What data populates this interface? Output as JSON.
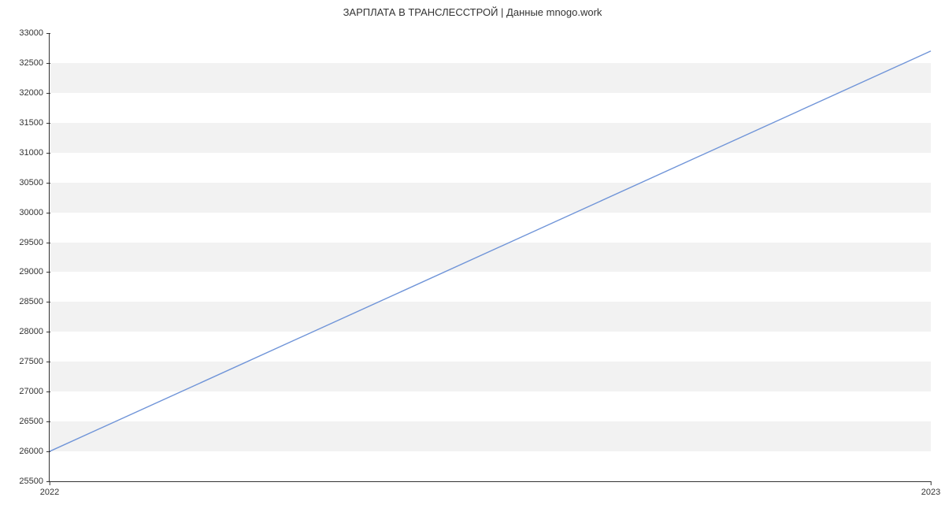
{
  "chart_data": {
    "type": "line",
    "title": "ЗАРПЛАТА В  ТРАНСЛЕССТРОЙ | Данные mnogo.work",
    "xlabel": "",
    "ylabel": "",
    "x": [
      2022,
      2023
    ],
    "values": [
      26000,
      32700
    ],
    "x_ticks": [
      2022,
      2023
    ],
    "y_ticks": [
      25500,
      26000,
      26500,
      27000,
      27500,
      28000,
      28500,
      29000,
      29500,
      30000,
      30500,
      31000,
      31500,
      32000,
      32500,
      33000
    ],
    "xlim": [
      2022,
      2023
    ],
    "ylim": [
      25500,
      33000
    ],
    "line_color": "#6f94d8",
    "band_color": "#f2f2f2"
  }
}
